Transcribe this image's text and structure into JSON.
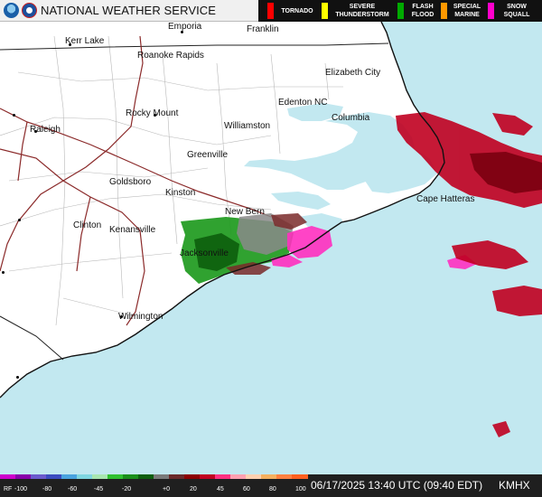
{
  "header": {
    "title": "NATIONAL WEATHER SERVICE",
    "logos": [
      {
        "icon": "noaa-logo",
        "name": "noaa-logo"
      },
      {
        "icon": "nws-logo",
        "name": "nws-logo"
      }
    ]
  },
  "legend": [
    {
      "label": "TORNADO",
      "color": "#ff0000"
    },
    {
      "label": "SEVERE\nTHUNDERSTORM",
      "color": "#ffff00"
    },
    {
      "label": "FLASH\nFLOOD",
      "color": "#00aa00"
    },
    {
      "label": "SPECIAL\nMARINE",
      "color": "#ff9900"
    },
    {
      "label": "SNOW\nSQUALL",
      "color": "#ff00cc"
    }
  ],
  "map": {
    "land_color": "#ffffff",
    "water_color": "#c2e8f0",
    "cities": [
      {
        "name": "Emporia"
      },
      {
        "name": "Franklin"
      },
      {
        "name": "Kerr Lake"
      },
      {
        "name": "Roanoke Rapids"
      },
      {
        "name": "Elizabeth City"
      },
      {
        "name": "Edenton NC"
      },
      {
        "name": "Rocky Mount"
      },
      {
        "name": "Columbia"
      },
      {
        "name": "Raleigh"
      },
      {
        "name": "Williamston"
      },
      {
        "name": "Greenville"
      },
      {
        "name": "Goldsboro"
      },
      {
        "name": "Kinston"
      },
      {
        "name": "Cape Hatteras"
      },
      {
        "name": "New Bern"
      },
      {
        "name": "Clinton"
      },
      {
        "name": "Kenansville"
      },
      {
        "name": "Jacksonville"
      },
      {
        "name": "Wilmington"
      }
    ]
  },
  "colorbar": {
    "labels": [
      "RF",
      "-100",
      "-80",
      "-60",
      "-45",
      "-20",
      "+0",
      "20",
      "45",
      "60",
      "80",
      "100"
    ],
    "colors": [
      "#cc00cc",
      "#8800aa",
      "#6a5acd",
      "#3b4cc0",
      "#4aa3df",
      "#7fd6e0",
      "#a8e6b0",
      "#30c030",
      "#1a8f1a",
      "#0d5e0d",
      "#7a7a7a",
      "#6a2a2a",
      "#8b0000",
      "#c00020",
      "#ff3080",
      "#ffa0b0",
      "#ffd0b0",
      "#f5b060",
      "#ff8040",
      "#ff6020"
    ]
  },
  "footer": {
    "timestamp": "06/17/2025 13:40 UTC (09:40 EDT)",
    "station": "KMHX"
  }
}
